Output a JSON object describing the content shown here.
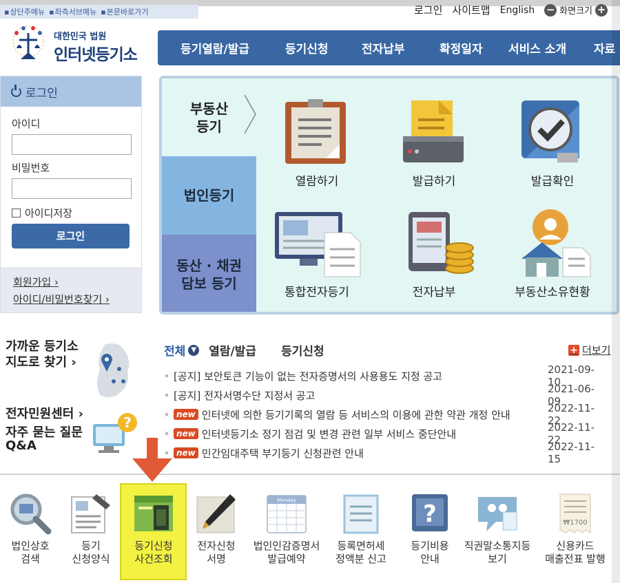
{
  "skip_links": [
    "상단주메뉴",
    "좌측서브메뉴",
    "본문바로가기"
  ],
  "util": {
    "login": "로그인",
    "sitemap": "사이트맵",
    "english": "English",
    "zoom": "화면크기",
    "zoom_out_icon": "minus-icon",
    "zoom_in_icon": "plus-icon"
  },
  "logo": {
    "small": "대한민국 법원",
    "big": "인터넷등기소"
  },
  "gnb": [
    "등기열람/발급",
    "등기신청",
    "전자납부",
    "확정일자",
    "서비스 소개",
    "자료"
  ],
  "login": {
    "title": "로그인",
    "id_label": "아이디",
    "id_value": "",
    "pw_label": "비밀번호",
    "pw_value": "",
    "save_id": "아이디저장",
    "button": "로그인",
    "join": "회원가입 ›",
    "find": "아이디/비밀번호찾기 ›"
  },
  "services": {
    "tabs": [
      "부동산\n등기",
      "법인등기",
      "동산 · 채권\n담보 등기"
    ],
    "items": [
      {
        "label": "열람하기",
        "icon": "document-view-icon"
      },
      {
        "label": "발급하기",
        "icon": "printer-icon"
      },
      {
        "label": "발급확인",
        "icon": "check-icon"
      },
      {
        "label": "통합전자등기",
        "icon": "monitor-document-icon"
      },
      {
        "label": "전자납부",
        "icon": "tablet-coins-icon"
      },
      {
        "label": "부동산소유현황",
        "icon": "house-owner-icon"
      }
    ]
  },
  "side": {
    "map_title_1": "가까운 등기소",
    "map_title_2": "지도로 찾기 ›",
    "center": "전자민원센터 ›",
    "faq_1": "자주 묻는 질문",
    "faq_2": "Q&A"
  },
  "news": {
    "tabs": [
      "전체",
      "열람/발급",
      "등기신청"
    ],
    "more": "더보기",
    "rows": [
      {
        "new": false,
        "title": "[공지] 보안토큰 기능이 없는 전자증명서의 사용용도 지정 공고",
        "date": "2021-09-10"
      },
      {
        "new": false,
        "title": "[공지] 전자서명수단 지정서 공고",
        "date": "2021-06-09"
      },
      {
        "new": true,
        "title": "인터넷에 의한 등기기록의 열람 등 서비스의 이용에 관한 약관 개정 안내",
        "date": "2022-11-22"
      },
      {
        "new": true,
        "title": "인터넷등기소 정기 점검 및 변경 관련 일부 서비스 중단안내",
        "date": "2022-11-22"
      },
      {
        "new": true,
        "title": "민간임대주택 부기등기 신청관련 안내",
        "date": "2022-11-15"
      }
    ],
    "new_badge": "new"
  },
  "quick": [
    {
      "l1": "법인상호",
      "l2": "검색",
      "icon": "magnifier-icon"
    },
    {
      "l1": "등기",
      "l2": "신청양식",
      "icon": "form-icon"
    },
    {
      "l1": "등기신청",
      "l2": "사건조회",
      "icon": "window-icon"
    },
    {
      "l1": "전자신청",
      "l2": "서명",
      "icon": "pen-icon"
    },
    {
      "l1": "법인인감증명서",
      "l2": "발급예약",
      "icon": "calendar-icon"
    },
    {
      "l1": "등록면허세",
      "l2": "정액분 신고",
      "icon": "paper-icon"
    },
    {
      "l1": "등기비용",
      "l2": "안내",
      "icon": "question-icon"
    },
    {
      "l1": "직권말소통지등",
      "l2": "보기",
      "icon": "speech-bubble-icon"
    },
    {
      "l1": "신용카드",
      "l2": "매출전표 발행",
      "icon": "receipt-icon"
    }
  ],
  "receipt_amount": "₩1700",
  "calendar_text": "Monday",
  "colors": {
    "nav": "#3867a4",
    "accent": "#d94a22",
    "highlight": "#f3f142"
  }
}
